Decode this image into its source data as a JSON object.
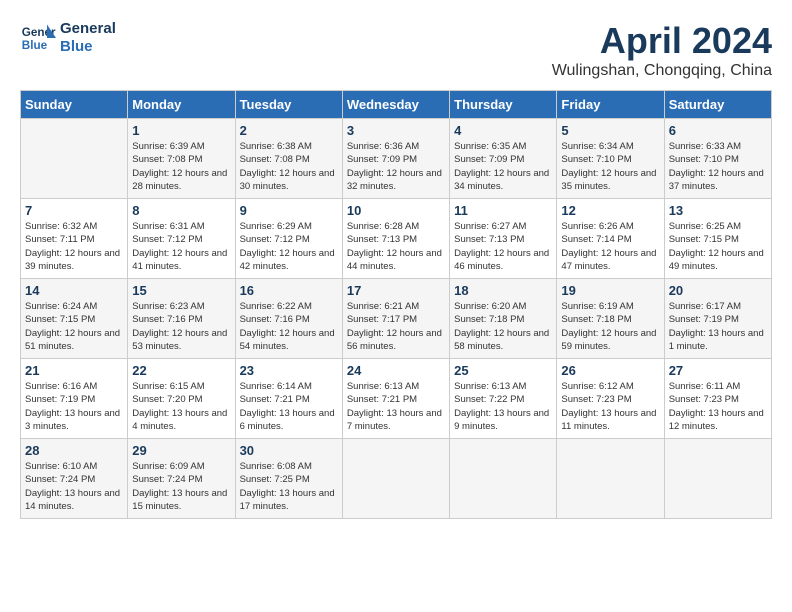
{
  "header": {
    "logo_line1": "General",
    "logo_line2": "Blue",
    "month": "April 2024",
    "location": "Wulingshan, Chongqing, China"
  },
  "days_of_week": [
    "Sunday",
    "Monday",
    "Tuesday",
    "Wednesday",
    "Thursday",
    "Friday",
    "Saturday"
  ],
  "weeks": [
    [
      {
        "num": "",
        "sunrise": "",
        "sunset": "",
        "daylight": ""
      },
      {
        "num": "1",
        "sunrise": "Sunrise: 6:39 AM",
        "sunset": "Sunset: 7:08 PM",
        "daylight": "Daylight: 12 hours and 28 minutes."
      },
      {
        "num": "2",
        "sunrise": "Sunrise: 6:38 AM",
        "sunset": "Sunset: 7:08 PM",
        "daylight": "Daylight: 12 hours and 30 minutes."
      },
      {
        "num": "3",
        "sunrise": "Sunrise: 6:36 AM",
        "sunset": "Sunset: 7:09 PM",
        "daylight": "Daylight: 12 hours and 32 minutes."
      },
      {
        "num": "4",
        "sunrise": "Sunrise: 6:35 AM",
        "sunset": "Sunset: 7:09 PM",
        "daylight": "Daylight: 12 hours and 34 minutes."
      },
      {
        "num": "5",
        "sunrise": "Sunrise: 6:34 AM",
        "sunset": "Sunset: 7:10 PM",
        "daylight": "Daylight: 12 hours and 35 minutes."
      },
      {
        "num": "6",
        "sunrise": "Sunrise: 6:33 AM",
        "sunset": "Sunset: 7:10 PM",
        "daylight": "Daylight: 12 hours and 37 minutes."
      }
    ],
    [
      {
        "num": "7",
        "sunrise": "Sunrise: 6:32 AM",
        "sunset": "Sunset: 7:11 PM",
        "daylight": "Daylight: 12 hours and 39 minutes."
      },
      {
        "num": "8",
        "sunrise": "Sunrise: 6:31 AM",
        "sunset": "Sunset: 7:12 PM",
        "daylight": "Daylight: 12 hours and 41 minutes."
      },
      {
        "num": "9",
        "sunrise": "Sunrise: 6:29 AM",
        "sunset": "Sunset: 7:12 PM",
        "daylight": "Daylight: 12 hours and 42 minutes."
      },
      {
        "num": "10",
        "sunrise": "Sunrise: 6:28 AM",
        "sunset": "Sunset: 7:13 PM",
        "daylight": "Daylight: 12 hours and 44 minutes."
      },
      {
        "num": "11",
        "sunrise": "Sunrise: 6:27 AM",
        "sunset": "Sunset: 7:13 PM",
        "daylight": "Daylight: 12 hours and 46 minutes."
      },
      {
        "num": "12",
        "sunrise": "Sunrise: 6:26 AM",
        "sunset": "Sunset: 7:14 PM",
        "daylight": "Daylight: 12 hours and 47 minutes."
      },
      {
        "num": "13",
        "sunrise": "Sunrise: 6:25 AM",
        "sunset": "Sunset: 7:15 PM",
        "daylight": "Daylight: 12 hours and 49 minutes."
      }
    ],
    [
      {
        "num": "14",
        "sunrise": "Sunrise: 6:24 AM",
        "sunset": "Sunset: 7:15 PM",
        "daylight": "Daylight: 12 hours and 51 minutes."
      },
      {
        "num": "15",
        "sunrise": "Sunrise: 6:23 AM",
        "sunset": "Sunset: 7:16 PM",
        "daylight": "Daylight: 12 hours and 53 minutes."
      },
      {
        "num": "16",
        "sunrise": "Sunrise: 6:22 AM",
        "sunset": "Sunset: 7:16 PM",
        "daylight": "Daylight: 12 hours and 54 minutes."
      },
      {
        "num": "17",
        "sunrise": "Sunrise: 6:21 AM",
        "sunset": "Sunset: 7:17 PM",
        "daylight": "Daylight: 12 hours and 56 minutes."
      },
      {
        "num": "18",
        "sunrise": "Sunrise: 6:20 AM",
        "sunset": "Sunset: 7:18 PM",
        "daylight": "Daylight: 12 hours and 58 minutes."
      },
      {
        "num": "19",
        "sunrise": "Sunrise: 6:19 AM",
        "sunset": "Sunset: 7:18 PM",
        "daylight": "Daylight: 12 hours and 59 minutes."
      },
      {
        "num": "20",
        "sunrise": "Sunrise: 6:17 AM",
        "sunset": "Sunset: 7:19 PM",
        "daylight": "Daylight: 13 hours and 1 minute."
      }
    ],
    [
      {
        "num": "21",
        "sunrise": "Sunrise: 6:16 AM",
        "sunset": "Sunset: 7:19 PM",
        "daylight": "Daylight: 13 hours and 3 minutes."
      },
      {
        "num": "22",
        "sunrise": "Sunrise: 6:15 AM",
        "sunset": "Sunset: 7:20 PM",
        "daylight": "Daylight: 13 hours and 4 minutes."
      },
      {
        "num": "23",
        "sunrise": "Sunrise: 6:14 AM",
        "sunset": "Sunset: 7:21 PM",
        "daylight": "Daylight: 13 hours and 6 minutes."
      },
      {
        "num": "24",
        "sunrise": "Sunrise: 6:13 AM",
        "sunset": "Sunset: 7:21 PM",
        "daylight": "Daylight: 13 hours and 7 minutes."
      },
      {
        "num": "25",
        "sunrise": "Sunrise: 6:13 AM",
        "sunset": "Sunset: 7:22 PM",
        "daylight": "Daylight: 13 hours and 9 minutes."
      },
      {
        "num": "26",
        "sunrise": "Sunrise: 6:12 AM",
        "sunset": "Sunset: 7:23 PM",
        "daylight": "Daylight: 13 hours and 11 minutes."
      },
      {
        "num": "27",
        "sunrise": "Sunrise: 6:11 AM",
        "sunset": "Sunset: 7:23 PM",
        "daylight": "Daylight: 13 hours and 12 minutes."
      }
    ],
    [
      {
        "num": "28",
        "sunrise": "Sunrise: 6:10 AM",
        "sunset": "Sunset: 7:24 PM",
        "daylight": "Daylight: 13 hours and 14 minutes."
      },
      {
        "num": "29",
        "sunrise": "Sunrise: 6:09 AM",
        "sunset": "Sunset: 7:24 PM",
        "daylight": "Daylight: 13 hours and 15 minutes."
      },
      {
        "num": "30",
        "sunrise": "Sunrise: 6:08 AM",
        "sunset": "Sunset: 7:25 PM",
        "daylight": "Daylight: 13 hours and 17 minutes."
      },
      {
        "num": "",
        "sunrise": "",
        "sunset": "",
        "daylight": ""
      },
      {
        "num": "",
        "sunrise": "",
        "sunset": "",
        "daylight": ""
      },
      {
        "num": "",
        "sunrise": "",
        "sunset": "",
        "daylight": ""
      },
      {
        "num": "",
        "sunrise": "",
        "sunset": "",
        "daylight": ""
      }
    ]
  ]
}
